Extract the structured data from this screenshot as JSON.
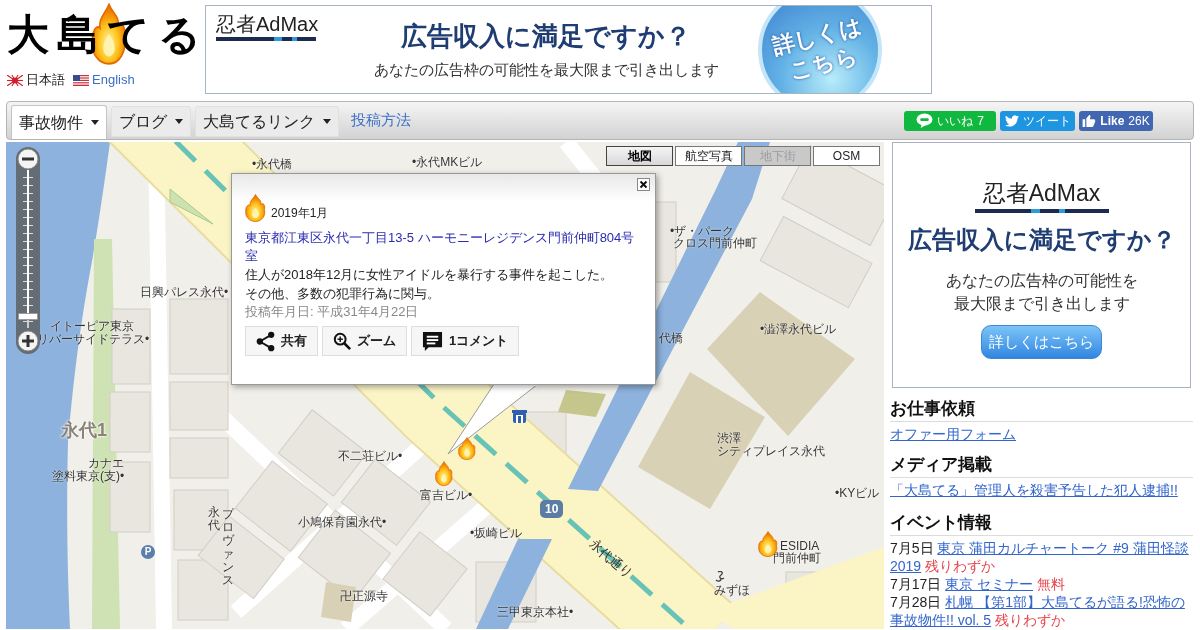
{
  "header": {
    "logo": "大島てる",
    "languages": [
      {
        "kind": "jp",
        "label": "日本語",
        "selected": true
      },
      {
        "kind": "us",
        "label": "English",
        "selected": false
      }
    ]
  },
  "top_ad": {
    "brand": "忍者AdMax",
    "headline": "広告収入に満足ですか？",
    "subline": "あなたの広告枠の可能性を最大限まで引き出します",
    "button_lines": [
      "詳しくは",
      "こちら"
    ]
  },
  "nav": {
    "items": [
      {
        "kind": "menu",
        "label": "事故物件",
        "selected": true
      },
      {
        "kind": "menu",
        "label": "ブログ",
        "selected": false
      },
      {
        "kind": "menu",
        "label": "大島てるリンク",
        "selected": false
      },
      {
        "kind": "link",
        "label": "投稿方法"
      }
    ],
    "social": [
      {
        "kind": "line",
        "label": "いいね",
        "count": "7"
      },
      {
        "kind": "twitter",
        "label": "ツイート"
      },
      {
        "kind": "facebook",
        "label": "Like",
        "count": "26K"
      }
    ]
  },
  "map": {
    "zoom_slider": {
      "level": 0.95
    },
    "map_types": [
      {
        "label": "地図",
        "selected": true,
        "disabled": false
      },
      {
        "label": "航空写真",
        "selected": false,
        "disabled": false
      },
      {
        "label": "地下街",
        "selected": false,
        "disabled": true
      },
      {
        "label": "OSM",
        "selected": false,
        "disabled": false
      }
    ],
    "labels": [
      {
        "kind": "place",
        "text": "•永代橋"
      },
      {
        "kind": "place",
        "text": "•永代MKビル"
      },
      {
        "kind": "place",
        "text": "日興パレス永代•"
      },
      {
        "kind": "place",
        "text": "イトーピア東京"
      },
      {
        "kind": "place",
        "text": "リバーサイドテラス•"
      },
      {
        "kind": "area",
        "text": "永代1"
      },
      {
        "kind": "place",
        "text": "カナエ"
      },
      {
        "kind": "place",
        "text": "塗料東京(支)•"
      },
      {
        "kind": "place",
        "text": "不二荘ビル•"
      },
      {
        "kind": "place",
        "text": "富吉ビル•"
      },
      {
        "kind": "place",
        "text": "小鳩保育園永代•"
      },
      {
        "kind": "place",
        "text": "卍正源寺"
      },
      {
        "kind": "place",
        "text": "•坂崎ビル"
      },
      {
        "kind": "place",
        "text": "三甲東京本社•"
      },
      {
        "kind": "place",
        "text": "•ザ・パーク"
      },
      {
        "kind": "place",
        "text": "クロス門前仲町"
      },
      {
        "kind": "place",
        "text": "•澁澤永代ビル"
      },
      {
        "kind": "place",
        "text": "渋澤"
      },
      {
        "kind": "place",
        "text": "シティプレイス永代"
      },
      {
        "kind": "place",
        "text": "•KYビル"
      },
      {
        "kind": "place",
        "text": "ESIDIA"
      },
      {
        "kind": "place",
        "text": "門前仲町"
      },
      {
        "kind": "place",
        "text": "みずほ"
      },
      {
        "kind": "place",
        "text": "代橋"
      },
      {
        "kind": "road",
        "text": "永代通り"
      },
      {
        "kind": "shield",
        "text": "10"
      },
      {
        "kind": "parking",
        "text": "P"
      },
      {
        "kind": "vertical",
        "text": "永代"
      },
      {
        "kind": "vertical",
        "text": "プロヴァンス"
      }
    ],
    "popup": {
      "date": "2019年1月",
      "address": "東京都江東区永代一丁目13-5 ハーモニーレジデンス門前仲町804号室",
      "description": [
        "住人が2018年12月に女性アイドルを暴行する事件を起こした。",
        "その他、多数の犯罪行為に関与。"
      ],
      "posted": "投稿年月日: 平成31年4月22日",
      "actions": [
        {
          "kind": "share",
          "label": "共有"
        },
        {
          "kind": "zoom",
          "label": "ズーム"
        },
        {
          "kind": "comment",
          "label": "1コメント"
        }
      ]
    }
  },
  "sidebar": {
    "ad": {
      "brand": "忍者AdMax",
      "headline": "広告収入に満足ですか？",
      "subline_lines": [
        "あなたの広告枠の可能性を",
        "最大限まで引き出します"
      ],
      "button": "詳しくはこちら"
    },
    "sections": [
      {
        "title": "お仕事依頼",
        "links": [
          "オファー用フォーム"
        ]
      },
      {
        "title": "メディア掲載",
        "links": [
          "「大島てる」管理人を殺害予告した犯人逮捕!!"
        ]
      },
      {
        "title": "イベント情報",
        "events": [
          {
            "date": "7月5日",
            "title": "東京 蒲田カルチャートーク #9 蒲田怪談2019",
            "note": "残りわずか"
          },
          {
            "date": "7月17日",
            "title": "東京 セミナー",
            "note": "無料"
          },
          {
            "date": "7月28日",
            "title": "札幌 【第1部】大島てるが語る!恐怖の事故物件!! vol. 5",
            "note": "残りわずか"
          }
        ]
      }
    ]
  }
}
